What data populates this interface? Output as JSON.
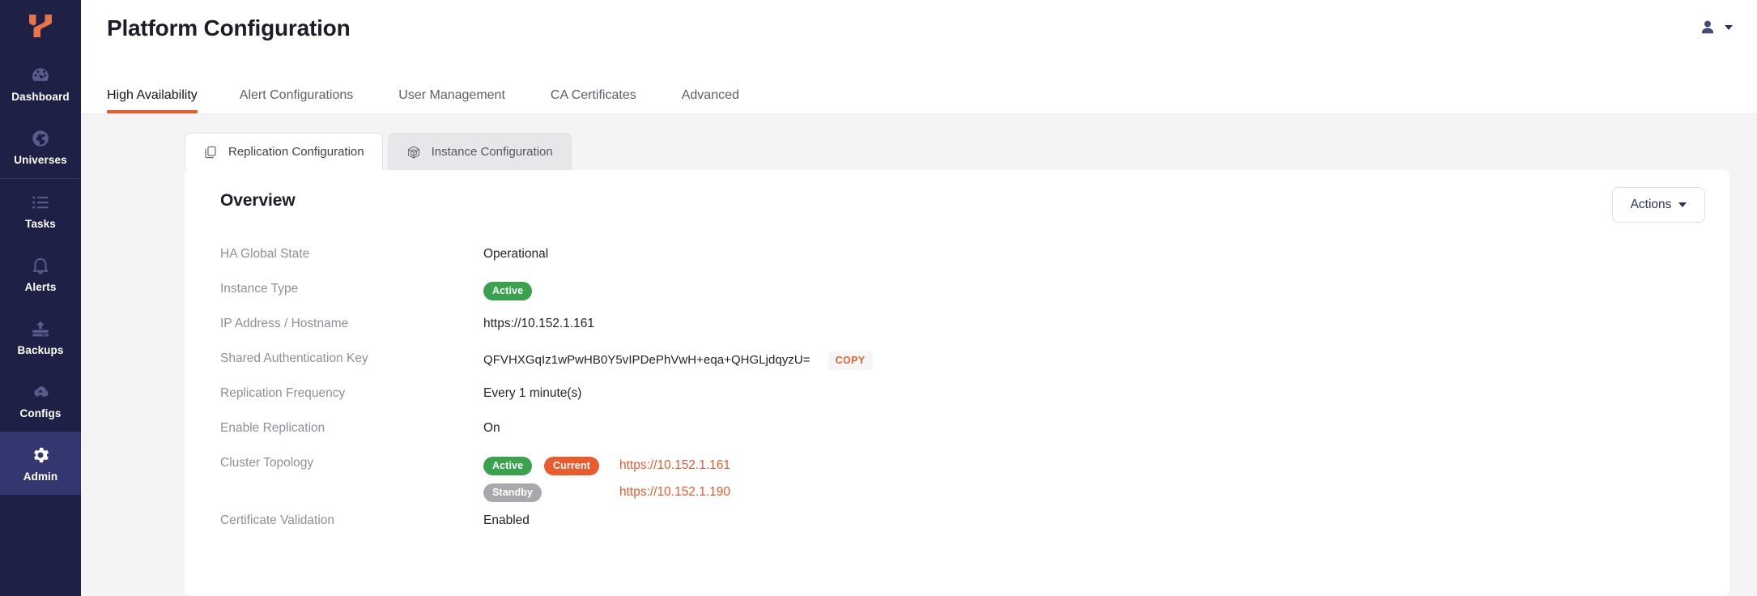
{
  "brand": {
    "logo_icon": "yugabyte-logo-icon"
  },
  "sidebar": {
    "items": [
      {
        "label": "Dashboard",
        "icon": "dashboard-icon",
        "active": false
      },
      {
        "label": "Universes",
        "icon": "globe-icon",
        "active": false
      },
      {
        "label": "Tasks",
        "icon": "list-icon",
        "active": false
      },
      {
        "label": "Alerts",
        "icon": "bell-icon",
        "active": false
      },
      {
        "label": "Backups",
        "icon": "backup-upload-icon",
        "active": false
      },
      {
        "label": "Configs",
        "icon": "cloud-upload-icon",
        "active": false
      },
      {
        "label": "Admin",
        "icon": "gear-icon",
        "active": true
      }
    ]
  },
  "header": {
    "title": "Platform Configuration",
    "profile_icon": "user-avatar-icon",
    "profile_caret_icon": "chevron-down-icon"
  },
  "tabs": [
    {
      "label": "High Availability",
      "active": true
    },
    {
      "label": "Alert Configurations",
      "active": false
    },
    {
      "label": "User Management",
      "active": false
    },
    {
      "label": "CA Certificates",
      "active": false
    },
    {
      "label": "Advanced",
      "active": false
    }
  ],
  "subtabs": [
    {
      "label": "Replication Configuration",
      "icon": "copy-documents-icon",
      "active": true
    },
    {
      "label": "Instance Configuration",
      "icon": "cube-network-icon",
      "active": false
    }
  ],
  "overview": {
    "title": "Overview",
    "actions_label": "Actions",
    "actions_caret_icon": "caret-down-icon",
    "rows": {
      "ha_global_state": {
        "label": "HA Global State",
        "value": "Operational"
      },
      "instance_type": {
        "label": "Instance Type",
        "badge": "Active"
      },
      "ip_address": {
        "label": "IP Address / Hostname",
        "value": "https://10.152.1.161"
      },
      "shared_auth_key": {
        "label": "Shared Authentication Key",
        "value": "QFVHXGqIz1wPwHB0Y5vIPDePhVwH+eqa+QHGLjdqyzU=",
        "copy_label": "COPY"
      },
      "replication_frequency": {
        "label": "Replication Frequency",
        "value": "Every 1 minute(s)"
      },
      "enable_replication": {
        "label": "Enable Replication",
        "value": "On"
      },
      "cluster_topology": {
        "label": "Cluster Topology",
        "nodes": [
          {
            "state": "Active",
            "current": "Current",
            "url": "https://10.152.1.161"
          },
          {
            "state": "Standby",
            "current": "",
            "url": "https://10.152.1.190"
          }
        ]
      },
      "certificate_validation": {
        "label": "Certificate Validation",
        "value": "Enabled"
      }
    }
  },
  "colors": {
    "accent_orange": "#ec5a2b",
    "sidebar_navy": "#1f2045",
    "sidebar_active": "#33366f",
    "badge_green": "#39a24c",
    "badge_grey": "#a7a9ad",
    "page_bg": "#f4f4f6"
  }
}
